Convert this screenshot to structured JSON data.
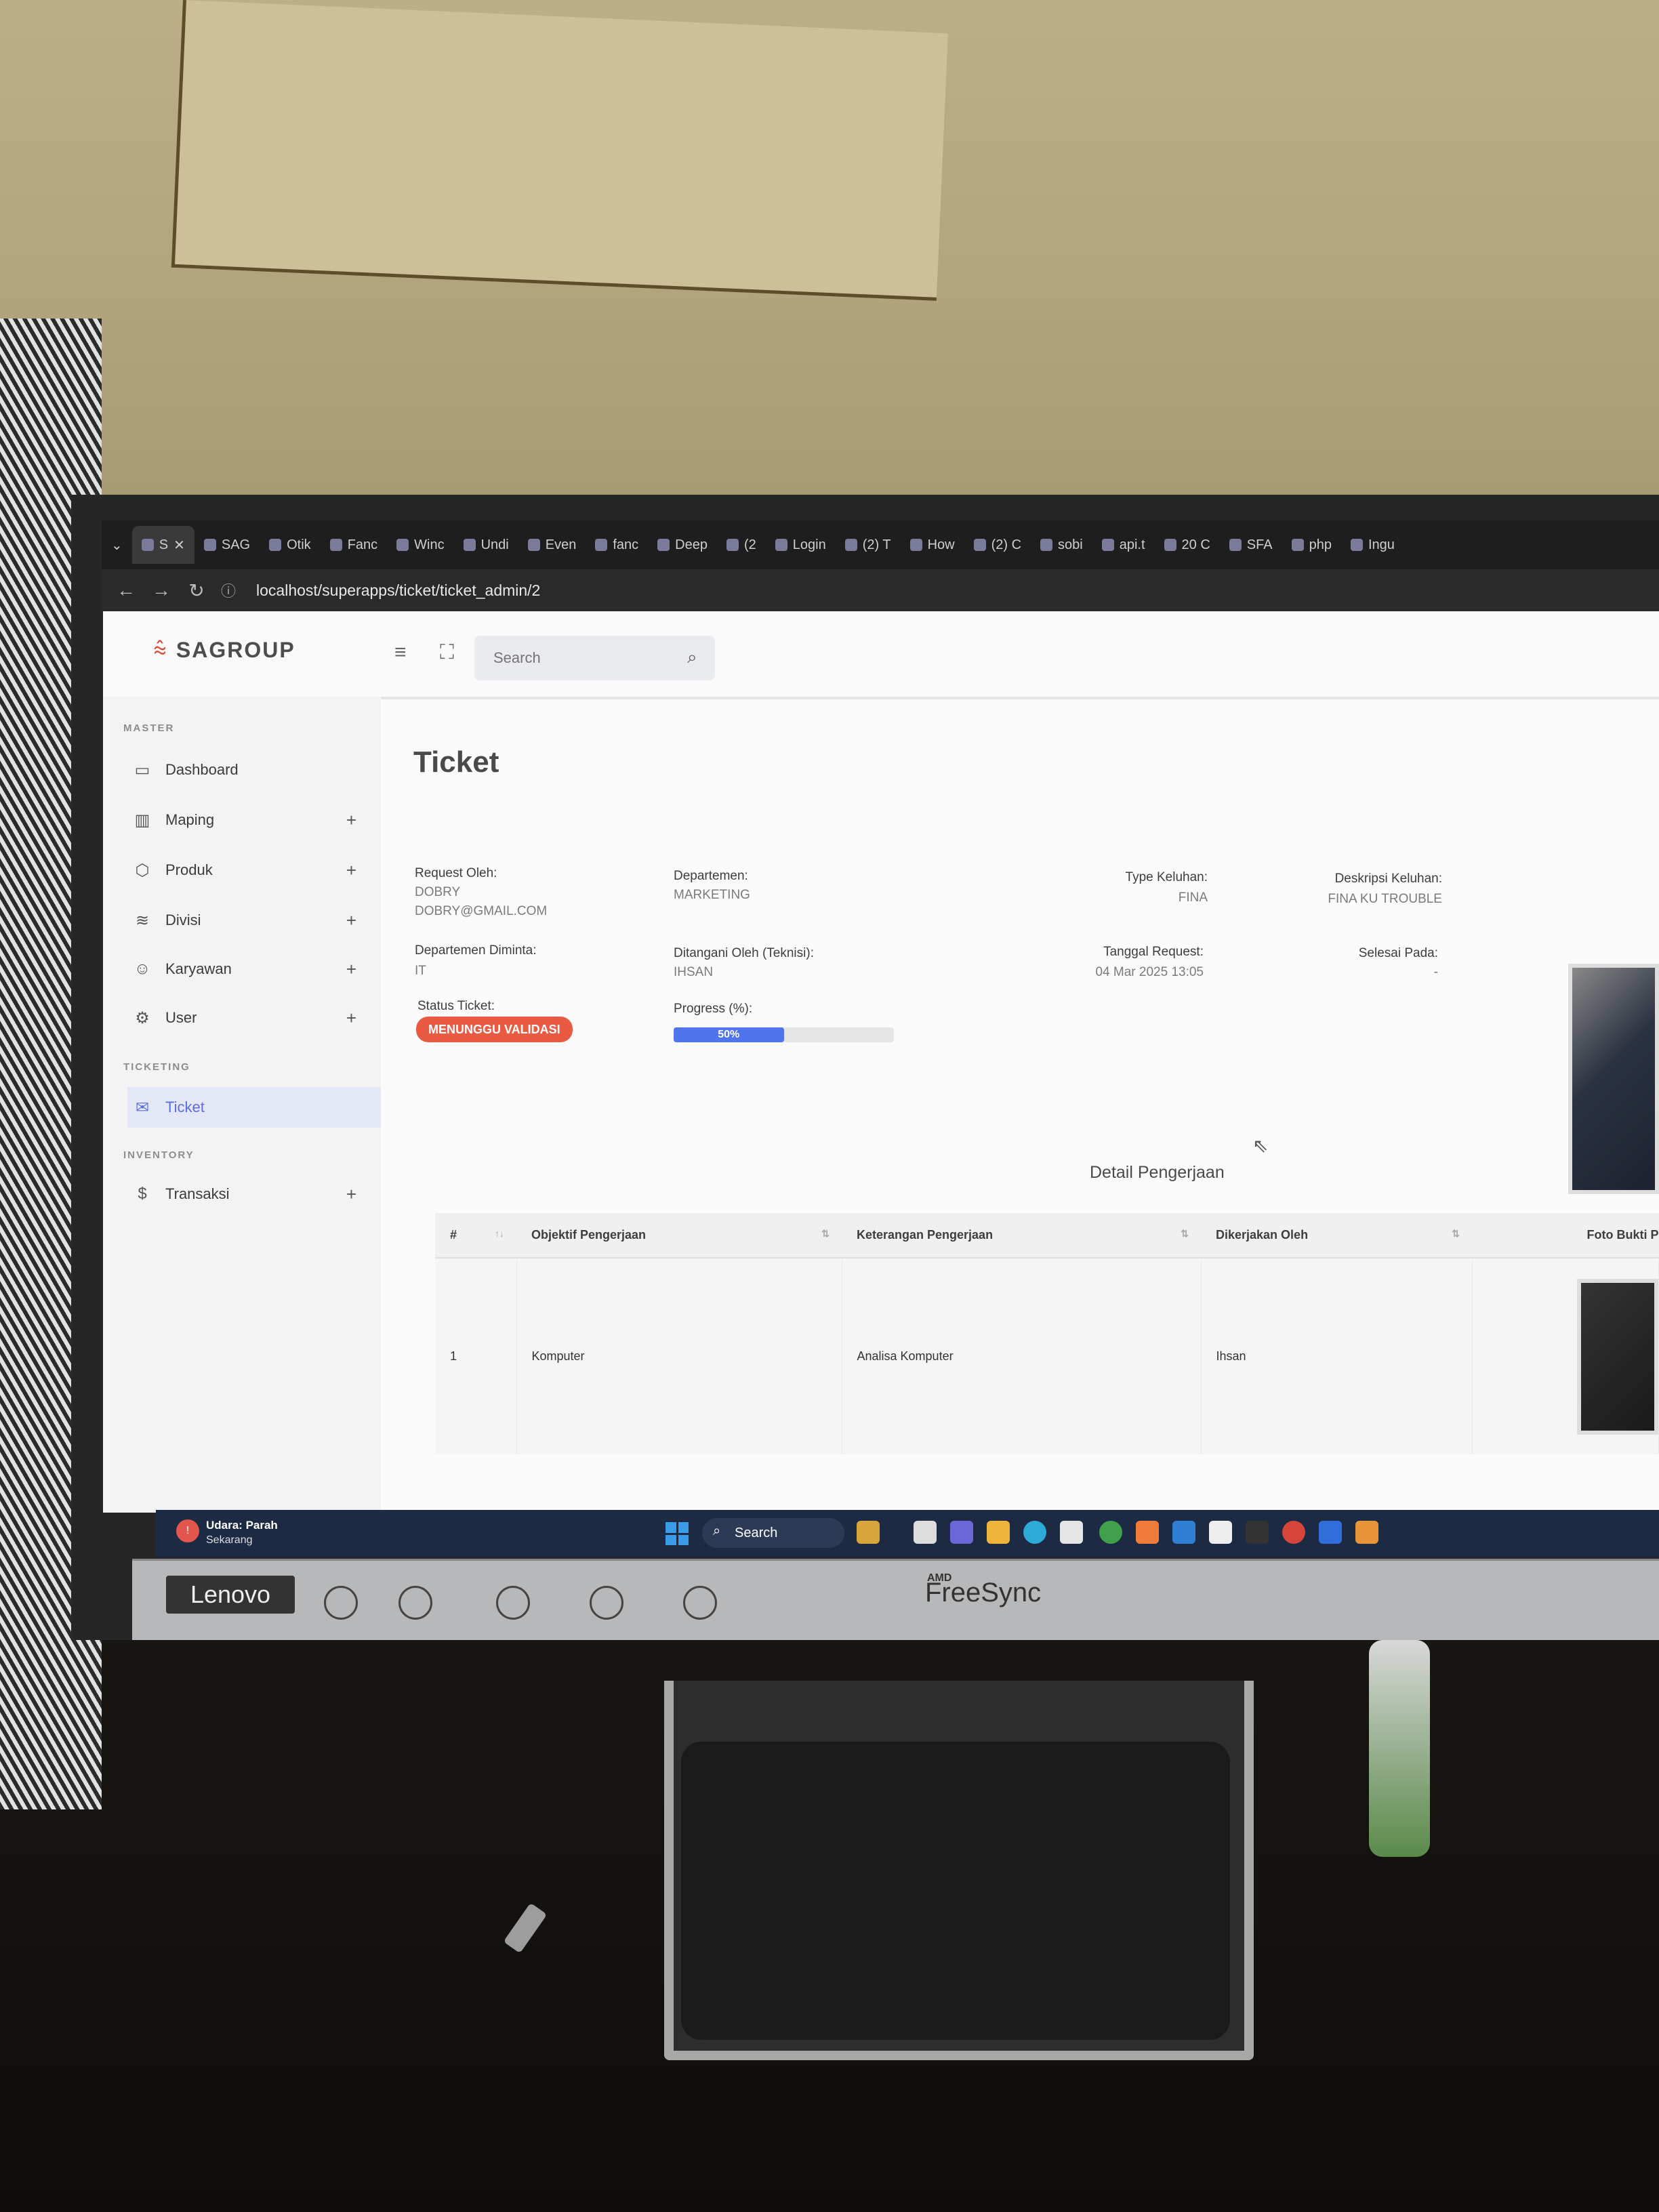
{
  "browser": {
    "tabs": [
      {
        "label": "S",
        "active": true
      },
      {
        "label": "SAG"
      },
      {
        "label": "Otik"
      },
      {
        "label": "Fanc"
      },
      {
        "label": "Winc"
      },
      {
        "label": "Undi"
      },
      {
        "label": "Even"
      },
      {
        "label": "fanc"
      },
      {
        "label": "Deep"
      },
      {
        "label": "(2"
      },
      {
        "label": "Login"
      },
      {
        "label": "(2) T"
      },
      {
        "label": "How"
      },
      {
        "label": "(2) C"
      },
      {
        "label": "sobi"
      },
      {
        "label": "api.t"
      },
      {
        "label": "20 C"
      },
      {
        "label": "SFA"
      },
      {
        "label": "php"
      },
      {
        "label": "Ingu"
      }
    ],
    "url": "localhost/superapps/ticket/ticket_admin/2"
  },
  "app": {
    "brand": "SAGROUP",
    "search": {
      "placeholder": "Search"
    }
  },
  "sidebar": {
    "sections": [
      "MASTER",
      "TICKETING",
      "INVENTORY"
    ],
    "items": [
      {
        "label": "Dashboard",
        "icon": "monitor-icon"
      },
      {
        "label": "Maping",
        "icon": "map-icon",
        "expand": "+"
      },
      {
        "label": "Produk",
        "icon": "box-icon",
        "expand": "+"
      },
      {
        "label": "Divisi",
        "icon": "layers-icon",
        "expand": "+"
      },
      {
        "label": "Karyawan",
        "icon": "users-icon",
        "expand": "+"
      },
      {
        "label": "User",
        "icon": "gear-icon",
        "expand": "+"
      },
      {
        "label": "Ticket",
        "icon": "ticket-icon",
        "active": true
      },
      {
        "label": "Transaksi",
        "icon": "dollar-icon",
        "expand": "+"
      }
    ]
  },
  "page": {
    "title": "Ticket",
    "fields": {
      "request_label": "Request Oleh:",
      "request_name": "DOBRY",
      "request_email": "DOBRY@GMAIL.COM",
      "dept_label": "Departemen:",
      "dept_value": "MARKETING",
      "type_label": "Type Keluhan:",
      "type_value": "FINA",
      "desc_label": "Deskripsi Keluhan:",
      "desc_value": "FINA KU TROUBLE",
      "dept_req_label": "Departemen Diminta:",
      "dept_req_value": "IT",
      "handler_label": "Ditangani Oleh (Teknisi):",
      "handler_value": "IHSAN",
      "date_label": "Tanggal Request:",
      "date_value": "04 Mar 2025 13:05",
      "done_label": "Selesai Pada:",
      "done_value": "-",
      "status_label": "Status Ticket:",
      "status_value": "MENUNGGU VALIDASI",
      "progress_label": "Progress (%):",
      "progress_text": "50%",
      "progress_fraction": 0.5
    },
    "detail_title": "Detail Pengerjaan",
    "table": {
      "headers": [
        "#",
        "Objektif Pengerjaan",
        "Keterangan Pengerjaan",
        "Dikerjakan Oleh",
        "Foto Bukti P"
      ],
      "rows": [
        {
          "no": "1",
          "objektif": "Komputer",
          "keterangan": "Analisa Komputer",
          "oleh": "Ihsan"
        }
      ]
    }
  },
  "taskbar": {
    "weather_title": "Udara: Parah",
    "weather_sub": "Sekarang",
    "search": "Search"
  },
  "monitor": {
    "brand": "Lenovo",
    "badge_small": "AMD",
    "badge": "FreeSync"
  },
  "colors": {
    "accent": "#5a6ee0",
    "status": "#e85a42",
    "progress": "#4f74ec"
  }
}
